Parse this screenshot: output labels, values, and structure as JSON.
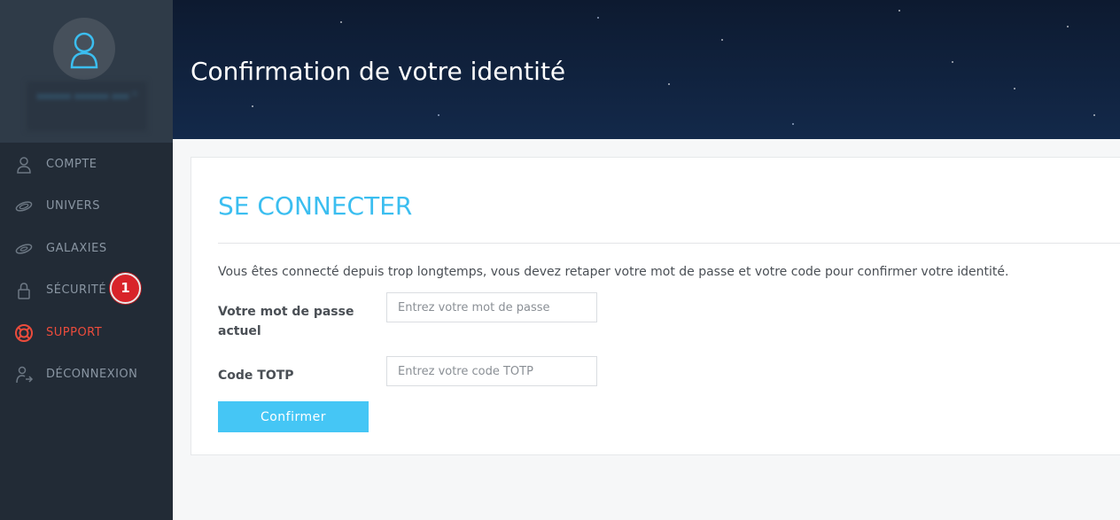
{
  "sidebar": {
    "profile": {
      "username_blurred": "•••••• ••••••\n••• ˅"
    },
    "items": [
      {
        "label": "COMPTE",
        "icon": "user-icon",
        "active": false
      },
      {
        "label": "UNIVERS",
        "icon": "galaxy-icon",
        "active": false
      },
      {
        "label": "GALAXIES",
        "icon": "galaxy-icon",
        "active": false
      },
      {
        "label": "SÉCURITÉ",
        "icon": "lock-icon",
        "active": false,
        "badge": "1"
      },
      {
        "label": "SUPPORT",
        "icon": "lifebuoy-icon",
        "active": true
      },
      {
        "label": "DÉCONNEXION",
        "icon": "logout-icon",
        "active": false
      }
    ]
  },
  "header": {
    "title": "Confirmation de votre identité"
  },
  "main": {
    "title": "SE CONNECTER",
    "message": "Vous êtes connecté depuis trop longtemps, vous devez retaper votre mot de passe et votre code pour confirmer votre identité.",
    "password": {
      "label": "Votre mot de passe actuel",
      "placeholder": "Entrez votre mot de passe",
      "value": ""
    },
    "totp": {
      "label": "Code TOTP",
      "placeholder": "Entrez votre code TOTP",
      "value": ""
    },
    "confirm_label": "Confirmer"
  },
  "colors": {
    "sidebar_bg": "#222b36",
    "accent": "#3bbef0",
    "active_nav": "#ec4c3c",
    "badge": "#d8232a",
    "button": "#45c6f5"
  }
}
